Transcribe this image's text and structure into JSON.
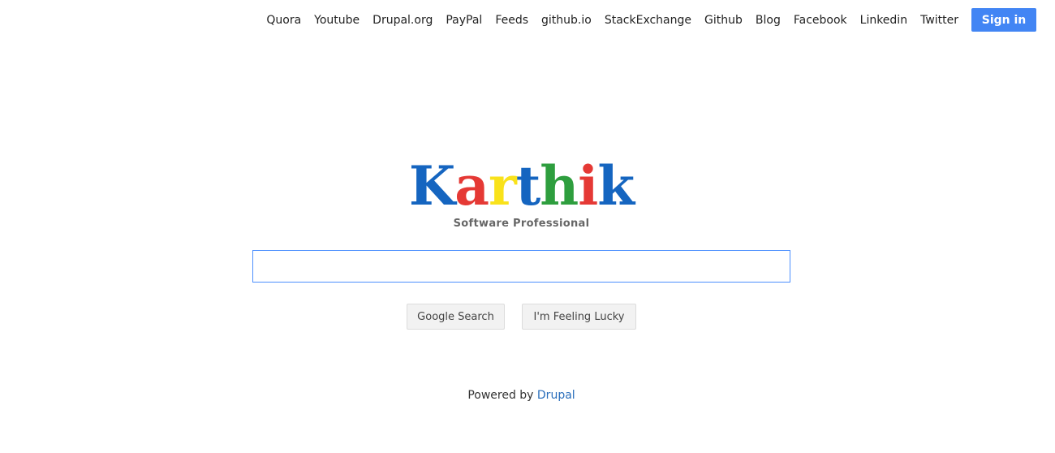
{
  "nav": {
    "links": [
      "Quora",
      "Youtube",
      "Drupal.org",
      "PayPal",
      "Feeds",
      "github.io",
      "StackExchange",
      "Github",
      "Blog",
      "Facebook",
      "Linkedin",
      "Twitter"
    ],
    "sign_in": "Sign in"
  },
  "logo": {
    "letters": [
      {
        "char": "K",
        "color": "#1565c0"
      },
      {
        "char": "a",
        "color": "#e53935"
      },
      {
        "char": "r",
        "color": "#f9e21b"
      },
      {
        "char": "t",
        "color": "#1565c0"
      },
      {
        "char": "h",
        "color": "#2e9e3e"
      },
      {
        "char": "i",
        "color": "#e53935"
      },
      {
        "char": "k",
        "color": "#1565c0"
      }
    ],
    "tagline": "Software Professional"
  },
  "search": {
    "value": "",
    "google_button": "Google Search",
    "lucky_button": "I'm Feeling Lucky"
  },
  "footer": {
    "prefix": "Powered by",
    "link": "Drupal"
  },
  "colors": {
    "sign_in_bg": "#4285f4",
    "link": "#2a6ebb",
    "focus_border": "#4d90fe"
  }
}
